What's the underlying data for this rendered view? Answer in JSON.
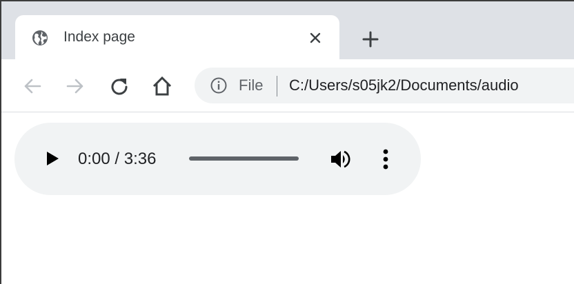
{
  "tab": {
    "title": "Index page",
    "icon": "globe-icon"
  },
  "toolbar": {
    "back_icon": "arrow-left-icon",
    "forward_icon": "arrow-right-icon",
    "reload_icon": "reload-icon",
    "home_icon": "home-icon"
  },
  "omnibox": {
    "scheme": "File",
    "url": "C:/Users/s05jk2/Documents/audio"
  },
  "audio_player": {
    "time": "0:00 / 3:36",
    "progress_fraction": 0
  },
  "colors": {
    "tabstrip": "#dee1e6",
    "omnibox": "#f1f3f4",
    "player": "#f1f3f4"
  }
}
